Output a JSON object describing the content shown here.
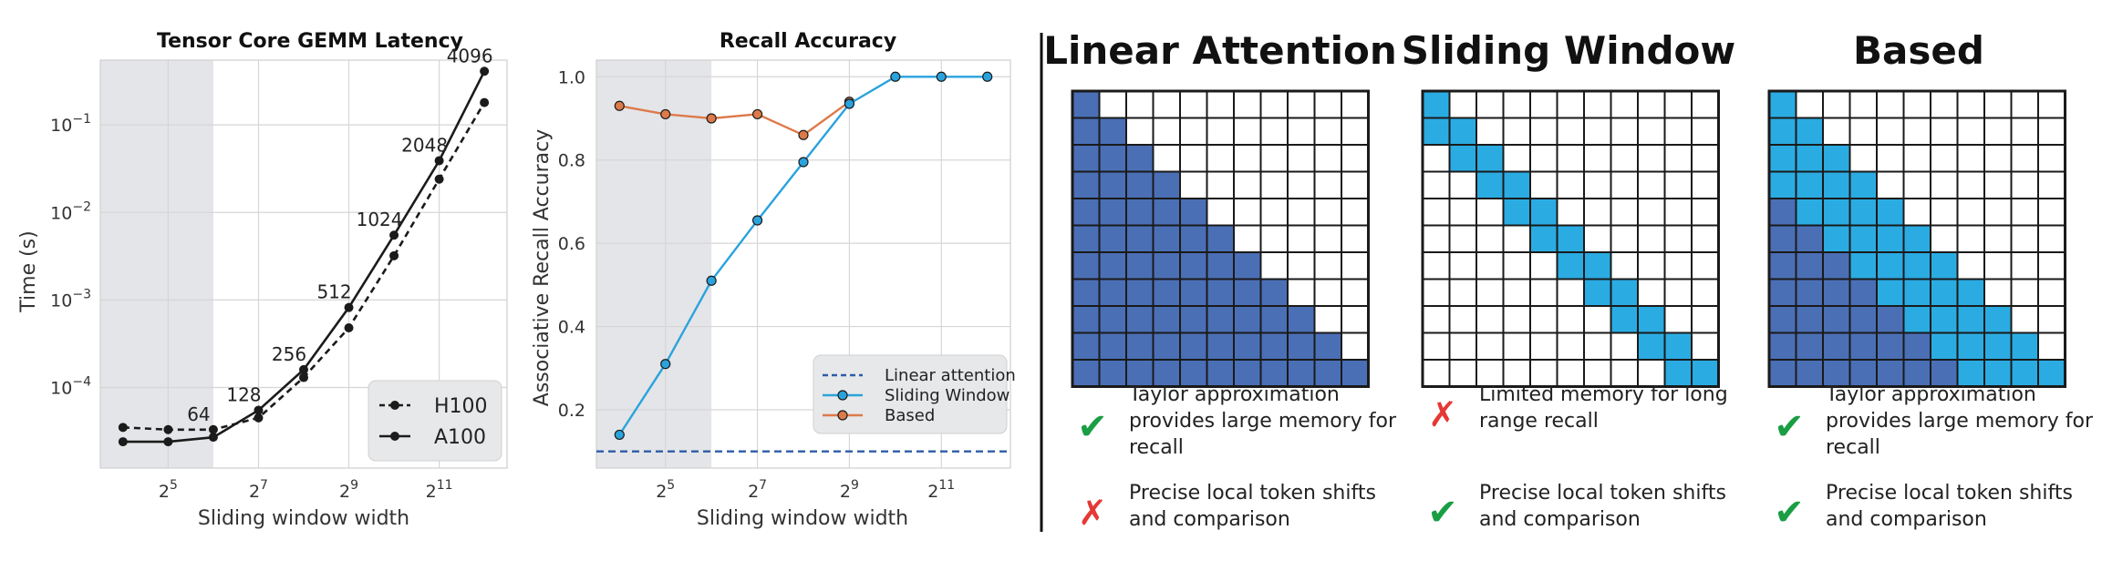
{
  "chart_data": [
    {
      "type": "line",
      "title": "Tensor Core GEMM Latency",
      "xlabel": "Sliding window width",
      "ylabel": "Time (s)",
      "x_scale": "log2",
      "y_scale": "log10",
      "x": [
        16,
        32,
        64,
        128,
        256,
        512,
        1024,
        2048,
        4096
      ],
      "xticks": [
        32,
        128,
        512,
        2048
      ],
      "xtick_labels": [
        [
          "2",
          "5"
        ],
        [
          "2",
          "7"
        ],
        [
          "2",
          "9"
        ],
        [
          "2",
          "11"
        ]
      ],
      "yticks": [
        0.0001,
        0.001,
        0.01,
        0.1
      ],
      "ytick_labels": [
        [
          "10",
          "−4"
        ],
        [
          "10",
          "−3"
        ],
        [
          "10",
          "−2"
        ],
        [
          "10",
          "−1"
        ]
      ],
      "xlim": [
        11.3,
        5800
      ],
      "ylim": [
        1.2e-05,
        0.55
      ],
      "shaded_region": [
        11.3,
        64
      ],
      "series": [
        {
          "name": "H100",
          "style": "dashed",
          "values": [
            3.5e-05,
            3.3e-05,
            3.3e-05,
            4.5e-05,
            0.00013,
            0.00048,
            0.0032,
            0.024,
            0.18
          ]
        },
        {
          "name": "A100",
          "style": "solid",
          "values": [
            2.4e-05,
            2.4e-05,
            2.7e-05,
            5.5e-05,
            0.00016,
            0.00082,
            0.0055,
            0.039,
            0.41
          ]
        }
      ],
      "point_labels": [
        "64",
        "128",
        "256",
        "512",
        "1024",
        "2048",
        "4096"
      ],
      "legend_position": "bottom-right",
      "grid": true
    },
    {
      "type": "line",
      "title": "Recall Accuracy",
      "xlabel": "Sliding window width",
      "ylabel": "Associative Recall Accuracy",
      "x_scale": "log2",
      "x": [
        16,
        32,
        64,
        128,
        256,
        512,
        1024,
        2048,
        4096
      ],
      "xticks": [
        32,
        128,
        512,
        2048
      ],
      "xtick_labels": [
        [
          "2",
          "5"
        ],
        [
          "2",
          "7"
        ],
        [
          "2",
          "9"
        ],
        [
          "2",
          "11"
        ]
      ],
      "yticks": [
        0.2,
        0.4,
        0.6,
        0.8,
        1.0
      ],
      "ytick_labels": [
        "0.2",
        "0.4",
        "0.6",
        "0.8",
        "1.0"
      ],
      "xlim": [
        11.3,
        5800
      ],
      "ylim": [
        0.06,
        1.04
      ],
      "shaded_region": [
        11.3,
        64
      ],
      "series": [
        {
          "name": "Linear attention",
          "style": "dashed",
          "color": "#2e5ca8",
          "constant": 0.1
        },
        {
          "name": "Sliding Window",
          "style": "solid",
          "color": "#2aa3dc",
          "x": [
            16,
            32,
            64,
            128,
            256,
            512,
            1024,
            2048,
            4096
          ],
          "values": [
            0.14,
            0.31,
            0.51,
            0.655,
            0.795,
            0.935,
            1.0,
            1.0,
            1.0
          ]
        },
        {
          "name": "Based",
          "style": "solid",
          "color": "#dd7a4a",
          "x": [
            16,
            32,
            64,
            128,
            256,
            512
          ],
          "values": [
            0.93,
            0.91,
            0.9,
            0.91,
            0.86,
            0.94
          ]
        }
      ],
      "legend_position": "lower-right",
      "grid": true
    }
  ],
  "colors": {
    "dark_blue": "#4a6fb5",
    "light_blue": "#2aace2",
    "grid_line": "#1a1a1a",
    "check": "#1a9e44",
    "cross": "#e53935",
    "shade": "#e4e5e8"
  },
  "panels": [
    {
      "title": "Linear Attention",
      "pattern": "causal",
      "notes": [
        {
          "icon": "check-icon",
          "lines": [
            "Taylor approximation",
            "provides large memory for",
            "recall"
          ]
        },
        {
          "icon": "cross-icon",
          "lines": [
            "Precise local token shifts",
            "and comparison"
          ]
        }
      ]
    },
    {
      "title": "Sliding Window",
      "pattern": "sliding",
      "notes": [
        {
          "icon": "cross-icon",
          "lines": [
            "Limited memory for long",
            "range recall"
          ]
        },
        {
          "icon": "check-icon",
          "lines": [
            "Precise local token shifts",
            "and comparison"
          ]
        }
      ]
    },
    {
      "title": "Based",
      "pattern": "based",
      "notes": [
        {
          "icon": "check-icon",
          "lines": [
            "Taylor approximation",
            "provides large memory for",
            "recall"
          ]
        },
        {
          "icon": "check-icon",
          "lines": [
            "Precise local token shifts",
            "and comparison"
          ]
        }
      ]
    }
  ]
}
